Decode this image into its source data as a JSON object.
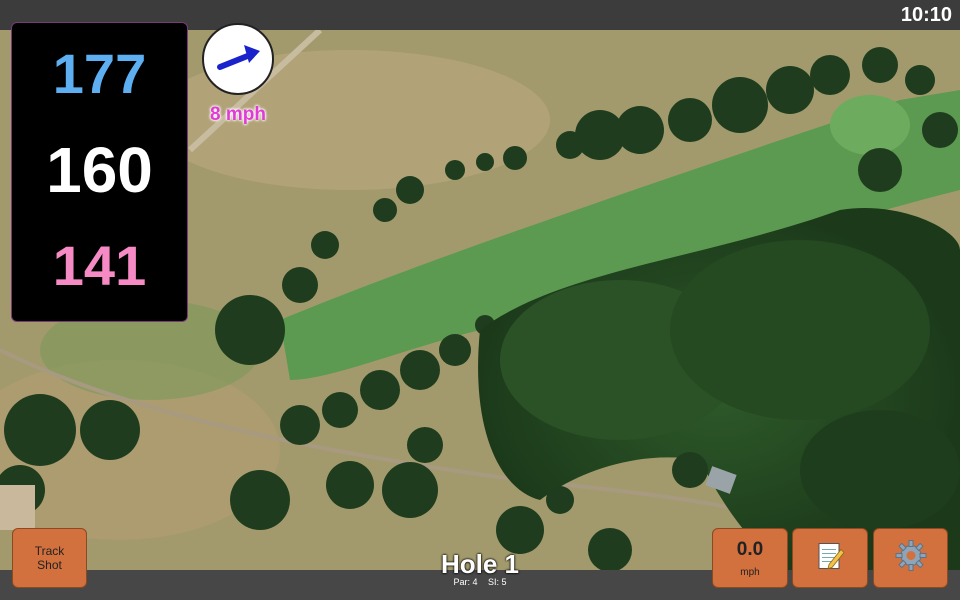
{
  "status_bar": {
    "time": "10:10"
  },
  "distances": {
    "back": "177",
    "middle": "160",
    "front": "141"
  },
  "wind": {
    "label": "8 mph",
    "speed_value": "0.0",
    "speed_unit": "mph"
  },
  "buttons": {
    "track_shot_line1": "Track",
    "track_shot_line2": "Shot"
  },
  "hole": {
    "title": "Hole 1",
    "par": "Par: 4",
    "stroke_index": "SI: 5"
  },
  "icons": {
    "wind_arrow": "arrow-icon",
    "notes": "notepad-icon",
    "settings": "gear-icon"
  },
  "colors": {
    "back_distance": "#5eaef2",
    "middle_distance": "#ffffff",
    "front_distance": "#f58ac4",
    "button_orange": "#d2703e",
    "wind_label": "#e23ad6"
  }
}
